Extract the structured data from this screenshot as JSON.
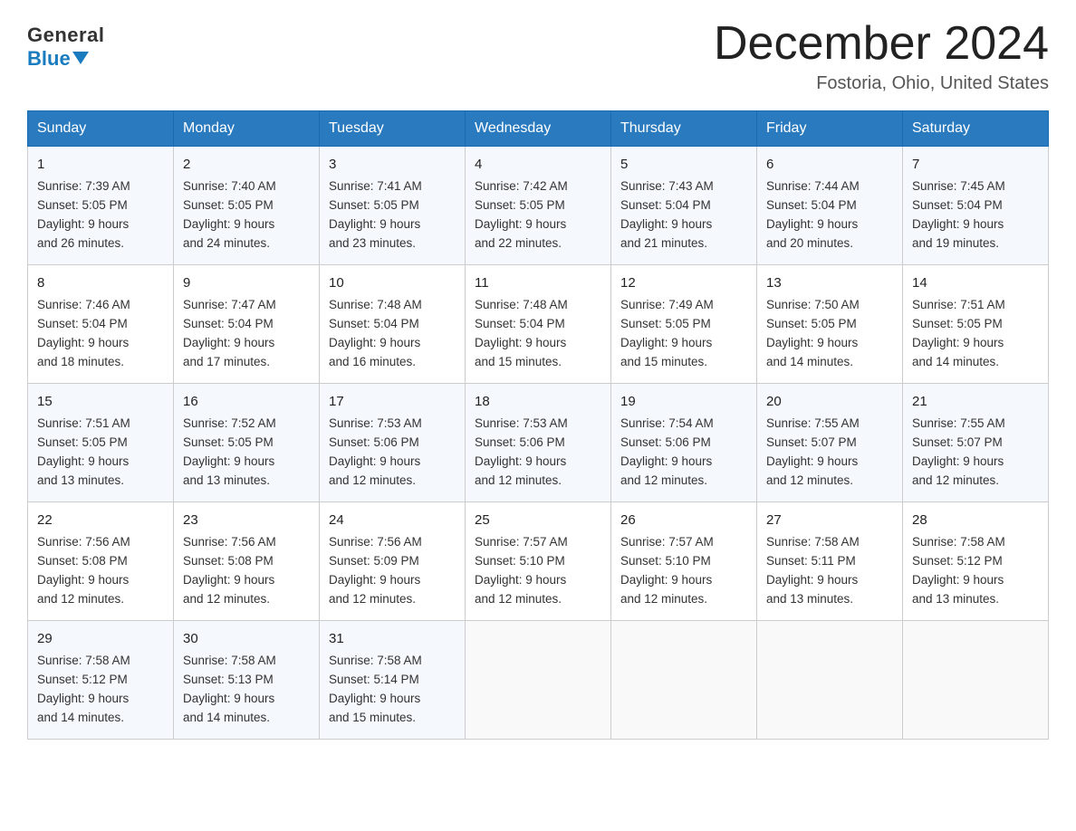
{
  "logo": {
    "general": "General",
    "blue": "Blue"
  },
  "title": "December 2024",
  "location": "Fostoria, Ohio, United States",
  "weekdays": [
    "Sunday",
    "Monday",
    "Tuesday",
    "Wednesday",
    "Thursday",
    "Friday",
    "Saturday"
  ],
  "weeks": [
    [
      {
        "day": "1",
        "info": "Sunrise: 7:39 AM\nSunset: 5:05 PM\nDaylight: 9 hours\nand 26 minutes."
      },
      {
        "day": "2",
        "info": "Sunrise: 7:40 AM\nSunset: 5:05 PM\nDaylight: 9 hours\nand 24 minutes."
      },
      {
        "day": "3",
        "info": "Sunrise: 7:41 AM\nSunset: 5:05 PM\nDaylight: 9 hours\nand 23 minutes."
      },
      {
        "day": "4",
        "info": "Sunrise: 7:42 AM\nSunset: 5:05 PM\nDaylight: 9 hours\nand 22 minutes."
      },
      {
        "day": "5",
        "info": "Sunrise: 7:43 AM\nSunset: 5:04 PM\nDaylight: 9 hours\nand 21 minutes."
      },
      {
        "day": "6",
        "info": "Sunrise: 7:44 AM\nSunset: 5:04 PM\nDaylight: 9 hours\nand 20 minutes."
      },
      {
        "day": "7",
        "info": "Sunrise: 7:45 AM\nSunset: 5:04 PM\nDaylight: 9 hours\nand 19 minutes."
      }
    ],
    [
      {
        "day": "8",
        "info": "Sunrise: 7:46 AM\nSunset: 5:04 PM\nDaylight: 9 hours\nand 18 minutes."
      },
      {
        "day": "9",
        "info": "Sunrise: 7:47 AM\nSunset: 5:04 PM\nDaylight: 9 hours\nand 17 minutes."
      },
      {
        "day": "10",
        "info": "Sunrise: 7:48 AM\nSunset: 5:04 PM\nDaylight: 9 hours\nand 16 minutes."
      },
      {
        "day": "11",
        "info": "Sunrise: 7:48 AM\nSunset: 5:04 PM\nDaylight: 9 hours\nand 15 minutes."
      },
      {
        "day": "12",
        "info": "Sunrise: 7:49 AM\nSunset: 5:05 PM\nDaylight: 9 hours\nand 15 minutes."
      },
      {
        "day": "13",
        "info": "Sunrise: 7:50 AM\nSunset: 5:05 PM\nDaylight: 9 hours\nand 14 minutes."
      },
      {
        "day": "14",
        "info": "Sunrise: 7:51 AM\nSunset: 5:05 PM\nDaylight: 9 hours\nand 14 minutes."
      }
    ],
    [
      {
        "day": "15",
        "info": "Sunrise: 7:51 AM\nSunset: 5:05 PM\nDaylight: 9 hours\nand 13 minutes."
      },
      {
        "day": "16",
        "info": "Sunrise: 7:52 AM\nSunset: 5:05 PM\nDaylight: 9 hours\nand 13 minutes."
      },
      {
        "day": "17",
        "info": "Sunrise: 7:53 AM\nSunset: 5:06 PM\nDaylight: 9 hours\nand 12 minutes."
      },
      {
        "day": "18",
        "info": "Sunrise: 7:53 AM\nSunset: 5:06 PM\nDaylight: 9 hours\nand 12 minutes."
      },
      {
        "day": "19",
        "info": "Sunrise: 7:54 AM\nSunset: 5:06 PM\nDaylight: 9 hours\nand 12 minutes."
      },
      {
        "day": "20",
        "info": "Sunrise: 7:55 AM\nSunset: 5:07 PM\nDaylight: 9 hours\nand 12 minutes."
      },
      {
        "day": "21",
        "info": "Sunrise: 7:55 AM\nSunset: 5:07 PM\nDaylight: 9 hours\nand 12 minutes."
      }
    ],
    [
      {
        "day": "22",
        "info": "Sunrise: 7:56 AM\nSunset: 5:08 PM\nDaylight: 9 hours\nand 12 minutes."
      },
      {
        "day": "23",
        "info": "Sunrise: 7:56 AM\nSunset: 5:08 PM\nDaylight: 9 hours\nand 12 minutes."
      },
      {
        "day": "24",
        "info": "Sunrise: 7:56 AM\nSunset: 5:09 PM\nDaylight: 9 hours\nand 12 minutes."
      },
      {
        "day": "25",
        "info": "Sunrise: 7:57 AM\nSunset: 5:10 PM\nDaylight: 9 hours\nand 12 minutes."
      },
      {
        "day": "26",
        "info": "Sunrise: 7:57 AM\nSunset: 5:10 PM\nDaylight: 9 hours\nand 12 minutes."
      },
      {
        "day": "27",
        "info": "Sunrise: 7:58 AM\nSunset: 5:11 PM\nDaylight: 9 hours\nand 13 minutes."
      },
      {
        "day": "28",
        "info": "Sunrise: 7:58 AM\nSunset: 5:12 PM\nDaylight: 9 hours\nand 13 minutes."
      }
    ],
    [
      {
        "day": "29",
        "info": "Sunrise: 7:58 AM\nSunset: 5:12 PM\nDaylight: 9 hours\nand 14 minutes."
      },
      {
        "day": "30",
        "info": "Sunrise: 7:58 AM\nSunset: 5:13 PM\nDaylight: 9 hours\nand 14 minutes."
      },
      {
        "day": "31",
        "info": "Sunrise: 7:58 AM\nSunset: 5:14 PM\nDaylight: 9 hours\nand 15 minutes."
      },
      {
        "day": "",
        "info": ""
      },
      {
        "day": "",
        "info": ""
      },
      {
        "day": "",
        "info": ""
      },
      {
        "day": "",
        "info": ""
      }
    ]
  ]
}
